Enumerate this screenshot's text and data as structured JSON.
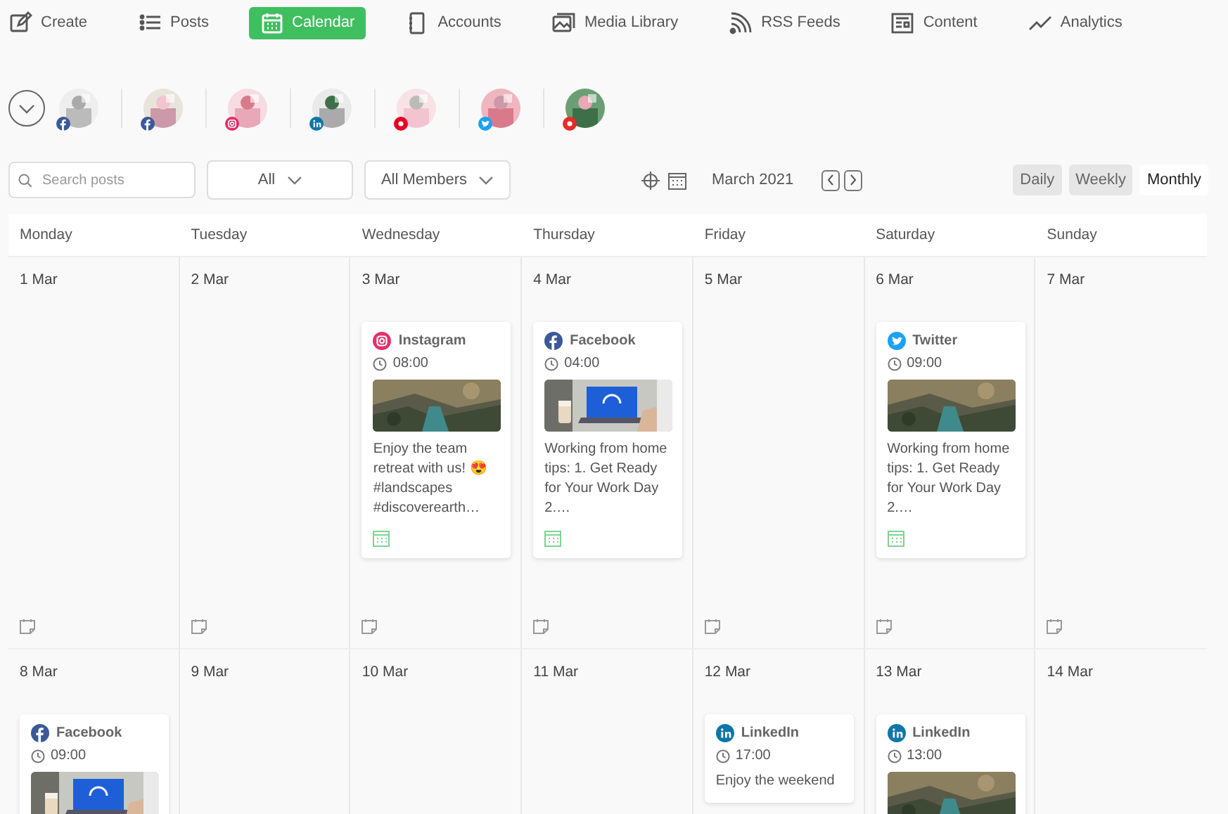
{
  "nav": [
    {
      "label": "Create",
      "selected": false
    },
    {
      "label": "Posts",
      "selected": false
    },
    {
      "label": "Calendar",
      "selected": true
    },
    {
      "label": "Accounts",
      "selected": false
    },
    {
      "label": "Media Library",
      "selected": false
    },
    {
      "label": "RSS Feeds",
      "selected": false
    },
    {
      "label": "Content",
      "selected": false
    },
    {
      "label": "Analytics",
      "selected": false
    }
  ],
  "accounts": [
    {
      "kind": "facebook"
    },
    {
      "kind": "facebook"
    },
    {
      "kind": "instagram"
    },
    {
      "kind": "linkedin"
    },
    {
      "kind": "pinterest"
    },
    {
      "kind": "twitter"
    },
    {
      "kind": "youtube"
    }
  ],
  "toolbar": {
    "search": {
      "placeholder": "Search posts"
    },
    "filters": [
      {
        "label": "All"
      },
      {
        "label": "All Members"
      }
    ],
    "month": "March 2021",
    "views": [
      {
        "label": "Daily",
        "selected": false
      },
      {
        "label": "Weekly",
        "selected": false
      },
      {
        "label": "Monthly",
        "selected": true
      }
    ]
  },
  "calendar": {
    "weekdays": [
      "Monday",
      "Tuesday",
      "Wednesday",
      "Thursday",
      "Friday",
      "Saturday",
      "Sunday"
    ],
    "weeks": [
      {
        "days": [
          {
            "date": "1 Mar"
          },
          {
            "date": "2 Mar"
          },
          {
            "date": "3 Mar",
            "posts": [
              {
                "kind": "instagram",
                "label": "Instagram",
                "time": "08:00",
                "caption": "Enjoy the team retreat with us! 😍 #landscapes #discoverearth…",
                "scheduled": true
              }
            ]
          },
          {
            "date": "4 Mar",
            "posts": [
              {
                "kind": "facebook",
                "label": "Facebook",
                "time": "04:00",
                "caption": "Working from home tips: 1. Get Ready for Your Work Day 2.…",
                "scheduled": true
              }
            ]
          },
          {
            "date": "5 Mar"
          },
          {
            "date": "6 Mar",
            "posts": [
              {
                "kind": "twitter",
                "label": "Twitter",
                "time": "09:00",
                "caption": "Working from home tips: 1. Get Ready for Your Work Day 2.…",
                "scheduled": true
              }
            ]
          },
          {
            "date": "7 Mar"
          }
        ]
      },
      {
        "days": [
          {
            "date": "8 Mar",
            "posts": [
              {
                "kind": "facebook",
                "label": "Facebook",
                "time": "09:00"
              }
            ]
          },
          {
            "date": "9 Mar"
          },
          {
            "date": "10 Mar"
          },
          {
            "date": "11 Mar"
          },
          {
            "date": "12 Mar",
            "posts": [
              {
                "kind": "linkedin",
                "label": "LinkedIn",
                "time": "17:00",
                "caption": "Enjoy the weekend"
              }
            ]
          },
          {
            "date": "13 Mar",
            "posts": [
              {
                "kind": "linkedin",
                "label": "LinkedIn",
                "time": "13:00"
              }
            ]
          },
          {
            "date": "14 Mar"
          }
        ]
      }
    ]
  }
}
